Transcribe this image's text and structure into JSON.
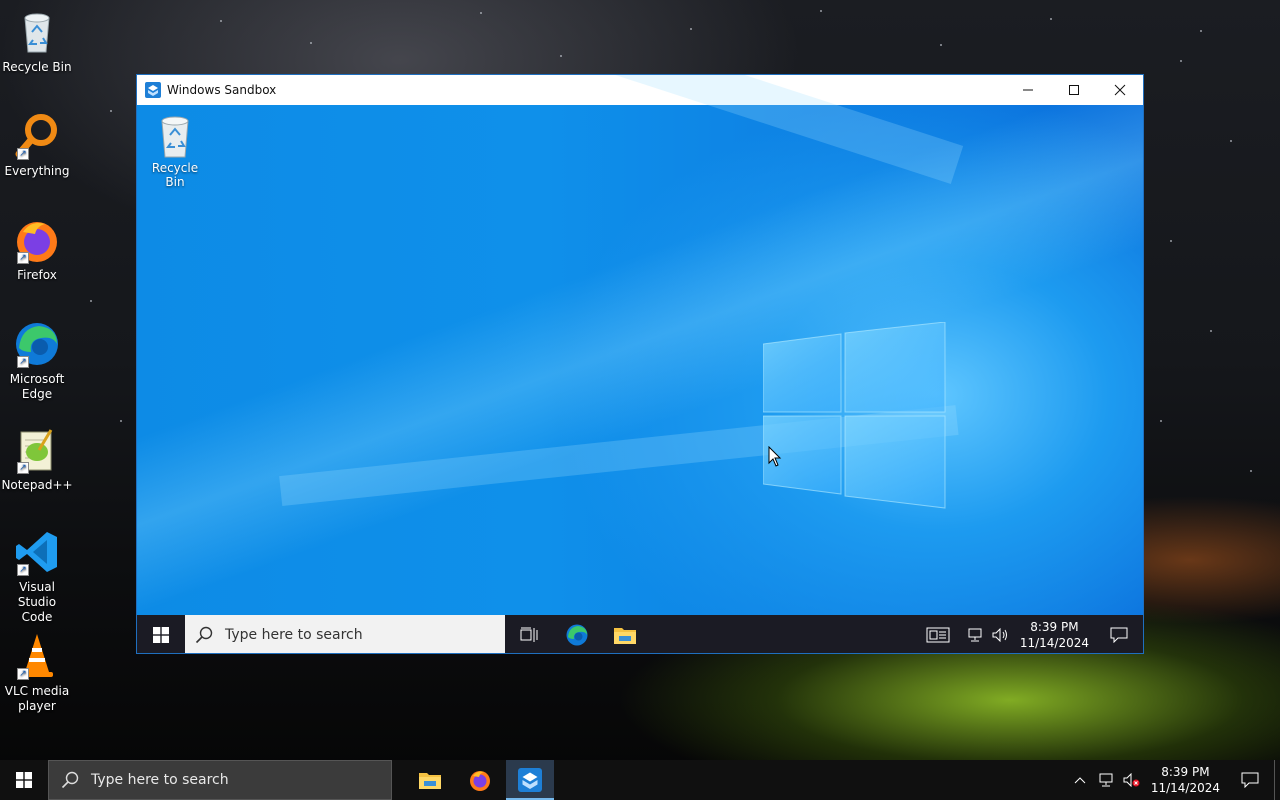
{
  "host_desktop": {
    "icons": [
      {
        "label": "Recycle Bin",
        "icon": "recycle-bin-icon"
      },
      {
        "label": "Everything",
        "icon": "everything-search-icon"
      },
      {
        "label": "Firefox",
        "icon": "firefox-icon"
      },
      {
        "label": "Microsoft Edge",
        "icon": "edge-icon"
      },
      {
        "label": "Notepad++",
        "icon": "notepadpp-icon"
      },
      {
        "label": "Visual Studio Code",
        "icon": "vscode-icon"
      },
      {
        "label": "VLC media player",
        "icon": "vlc-icon"
      }
    ]
  },
  "sandbox_window": {
    "title": "Windows Sandbox",
    "controls": [
      "minimize",
      "maximize",
      "close"
    ],
    "vm_desktop": {
      "icons": [
        {
          "label": "Recycle Bin",
          "icon": "recycle-bin-icon"
        }
      ]
    },
    "vm_taskbar": {
      "search_placeholder": "Type here to search",
      "pinned": [
        "task-view",
        "edge",
        "file-explorer"
      ],
      "clock_time": "8:39 PM",
      "clock_date": "11/14/2024"
    }
  },
  "host_taskbar": {
    "search_placeholder": "Type here to search",
    "pinned": [
      "file-explorer",
      "firefox",
      "windows-sandbox"
    ],
    "active_app": "windows-sandbox",
    "clock_time": "8:39 PM",
    "clock_date": "11/14/2024"
  },
  "colors": {
    "vm_wallpaper": "#0f90ea",
    "taskbar": "#101010",
    "accent": "#76b9ed"
  }
}
